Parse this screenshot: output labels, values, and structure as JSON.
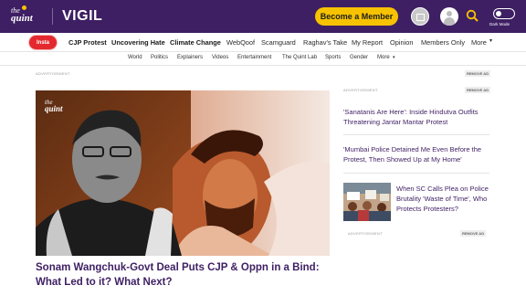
{
  "header": {
    "logo_line1": "the",
    "logo_line2": "quint",
    "brand": "VIGIL",
    "member_button": "Become a Member",
    "dark_mode_label": "Dark Mode",
    "icons": [
      "gift-icon",
      "avatar-icon",
      "search-icon",
      "toggle-icon"
    ],
    "accent_color": "#3e1f63",
    "button_color": "#f7c300"
  },
  "nav_primary": {
    "badge": "Insta",
    "items": [
      "CJP Protest",
      "Uncovering Hate",
      "Climate Change",
      "WebQoof",
      "Scamguard",
      "Raghav's Take",
      "My Report",
      "Opinion",
      "Members Only",
      "More"
    ]
  },
  "nav_secondary": {
    "items": [
      "World",
      "Politics",
      "Explainers",
      "Videos",
      "Entertainment",
      "The Quint Lab",
      "Sports",
      "Gender",
      "More"
    ]
  },
  "ads": {
    "label": "ADVERTISEMENT",
    "remove": "REMOVE AD"
  },
  "hero": {
    "logo_line1": "the",
    "logo_line2": "quint",
    "title": "Sonam Wangchuk-Govt Deal Puts CJP & Oppn in a Bind: What Led to it? What Next?"
  },
  "sidebar": {
    "links": [
      "'Sanatanis Are Here': Inside Hindutva Outfits Threatening Jantar Mantar Protest",
      "'Mumbai Police Detained Me Even Before the Protest, Then Showed Up at My Home'"
    ],
    "card_title": "When SC Calls Plea on Police Brutality 'Waste of Time', Who Protects Protesters?"
  }
}
